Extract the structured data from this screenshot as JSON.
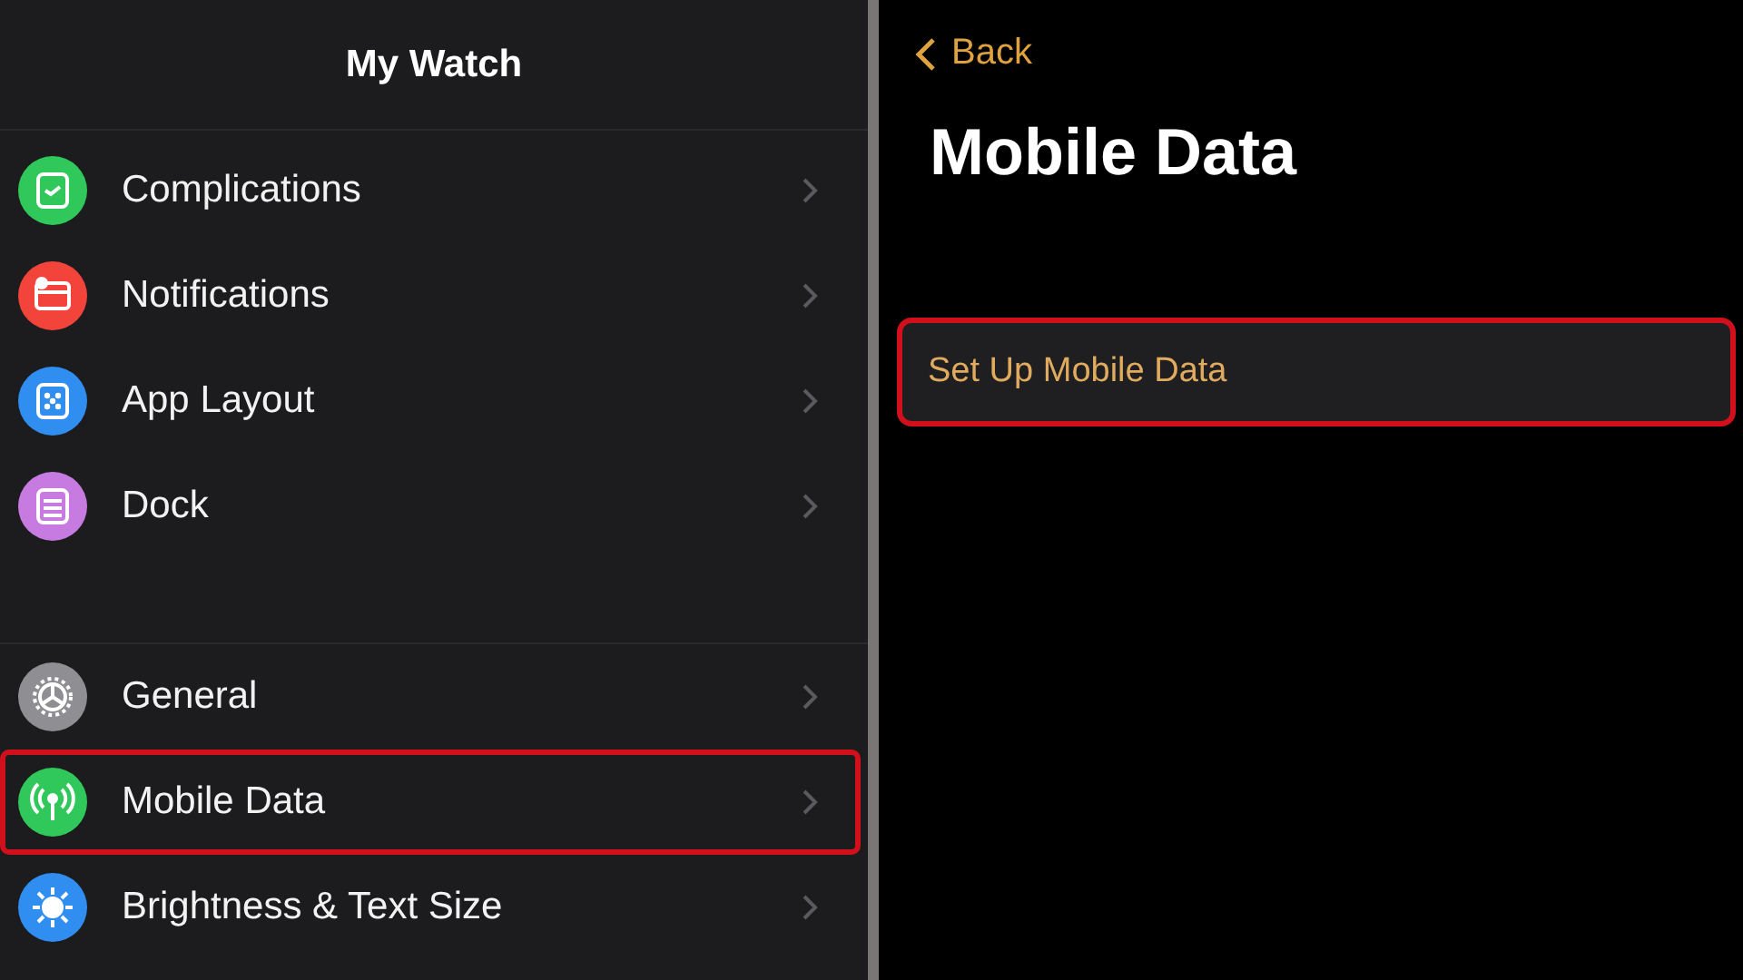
{
  "left_panel": {
    "title": "My Watch",
    "groups": [
      {
        "items": [
          {
            "label": "Complications",
            "kind": "watch-face",
            "color": "#30c85a",
            "highlighted": false
          },
          {
            "label": "Notifications",
            "kind": "notification",
            "color": "#f2443a",
            "highlighted": false
          },
          {
            "label": "App Layout",
            "kind": "app-grid",
            "color": "#2f8ef0",
            "highlighted": false
          },
          {
            "label": "Dock",
            "kind": "dock",
            "color": "#c77be0",
            "highlighted": false
          }
        ]
      },
      {
        "items": [
          {
            "label": "General",
            "kind": "gear",
            "color": "#8e8e93",
            "highlighted": false
          },
          {
            "label": "Mobile Data",
            "kind": "antenna",
            "color": "#30c85a",
            "highlighted": true
          },
          {
            "label": "Brightness & Text Size",
            "kind": "sun",
            "color": "#2f8ef0",
            "highlighted": false
          }
        ]
      }
    ]
  },
  "right_panel": {
    "back": "Back",
    "title": "Mobile Data",
    "button": {
      "label": "Set Up Mobile Data",
      "highlighted": true
    }
  }
}
